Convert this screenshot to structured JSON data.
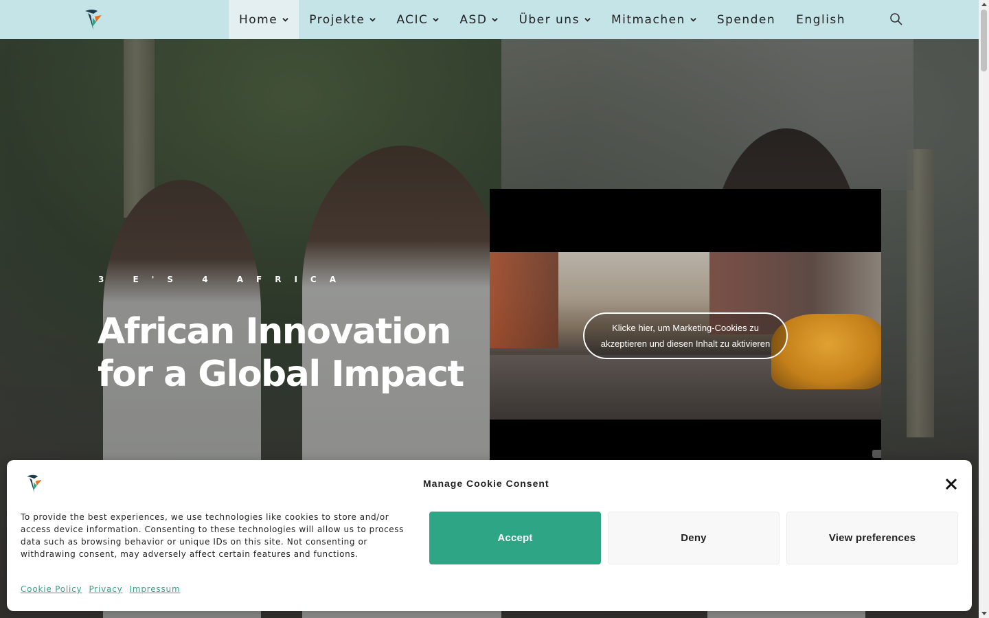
{
  "header": {
    "logo_icon": "3es4africa-logo-icon",
    "nav": [
      {
        "label": "Home",
        "has_dropdown": true,
        "active": true
      },
      {
        "label": "Projekte",
        "has_dropdown": true
      },
      {
        "label": "ACIC",
        "has_dropdown": true
      },
      {
        "label": "ASD",
        "has_dropdown": true
      },
      {
        "label": "Über uns",
        "has_dropdown": true
      },
      {
        "label": "Mitmachen",
        "has_dropdown": true
      },
      {
        "label": "Spenden",
        "has_dropdown": false
      },
      {
        "label": "English",
        "has_dropdown": false
      }
    ],
    "search_icon": "search-icon",
    "background_color": "#c4e4e8"
  },
  "hero": {
    "eyebrow": "3 E'S 4 AFRICA",
    "title": "African Innovation for a Global Impact",
    "video": {
      "consent_text": "Klicke hier, um Marketing-Cookies zu akzeptieren und diesen Inhalt zu aktivieren"
    }
  },
  "cookie_banner": {
    "title": "Manage Cookie Consent",
    "text": "To provide the best experiences, we use technologies like cookies to store and/or access device information. Consenting to these technologies will allow us to process data such as browsing behavior or unique IDs on this site. Not consenting or withdrawing consent, may adversely affect certain features and functions.",
    "buttons": {
      "accept": "Accept",
      "deny": "Deny",
      "preferences": "View preferences"
    },
    "links": [
      "Cookie Policy",
      "Privacy",
      "Impressum"
    ],
    "accent_color": "#2ea685",
    "close_icon": "close-icon"
  }
}
